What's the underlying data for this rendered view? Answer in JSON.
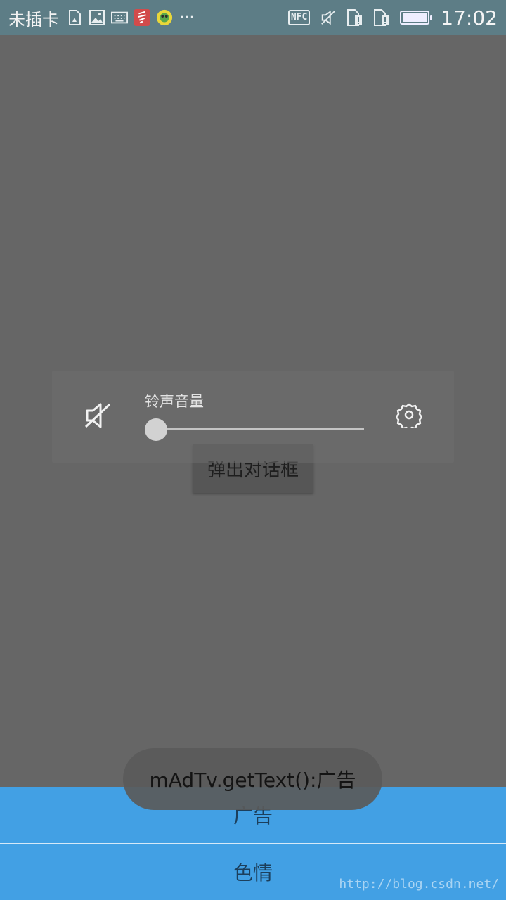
{
  "status_bar": {
    "carrier": "未插卡",
    "icons_left": [
      "sim-missing-icon",
      "image-icon",
      "keyboard-icon",
      "app-notification-icon",
      "game-app-icon",
      "more-dots-icon"
    ],
    "icons_right": [
      "nfc-icon",
      "silent-icon",
      "sim1-alert-icon",
      "sim2-alert-icon",
      "battery-icon"
    ],
    "nfc_label": "NFC",
    "more_label": "···",
    "battery_level": 1.0,
    "time": "17:02"
  },
  "app": {
    "dialog_button_label": "弹出对话框",
    "bottom_items": [
      {
        "label": "广告"
      },
      {
        "label": "色情"
      }
    ],
    "accent_color": "#42a0e4",
    "watermark": "http://blog.csdn.net/"
  },
  "volume_panel": {
    "title": "铃声音量",
    "level": 0,
    "mute_icon": "speaker-muted-icon",
    "settings_icon": "gear-icon"
  },
  "toast": {
    "text": "mAdTv.getText():广告"
  }
}
